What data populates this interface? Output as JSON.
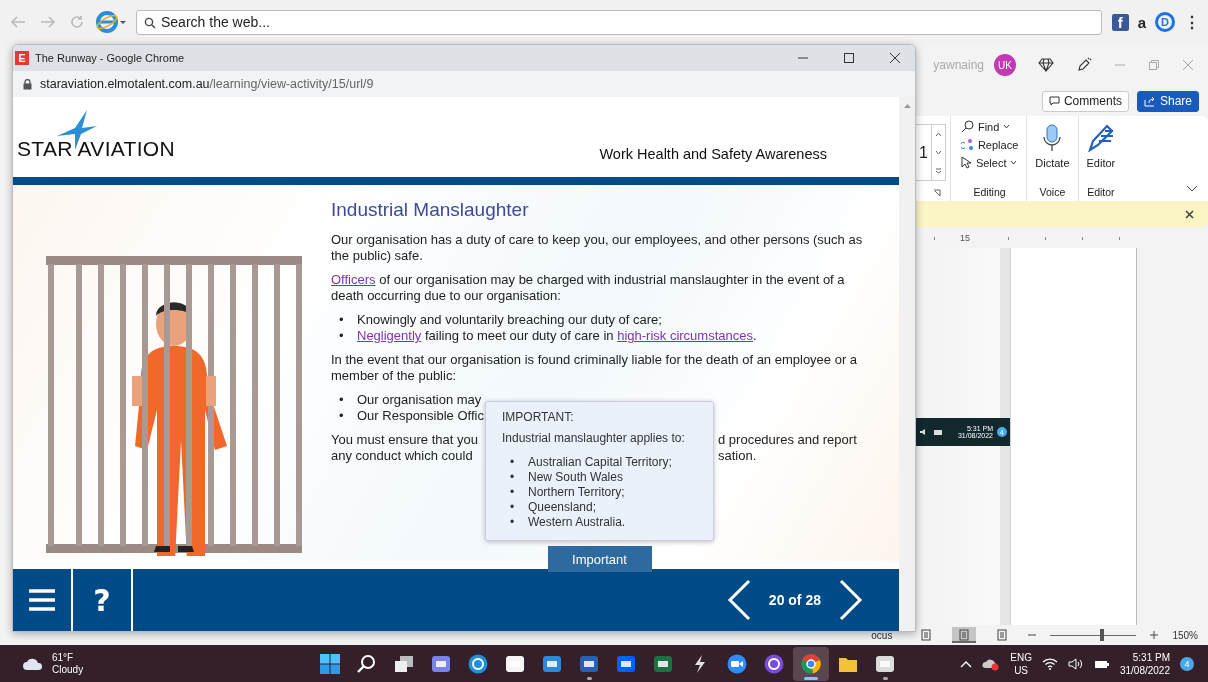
{
  "browser_bar": {
    "search": {
      "placeholder": "Search the web..."
    },
    "extensions": [
      {
        "kind": "facebook",
        "label": "f"
      },
      {
        "kind": "amazon",
        "label": "a"
      },
      {
        "kind": "circle",
        "label": "D"
      }
    ],
    "menu": "⋮"
  },
  "word_window": {
    "user": "yawnaing",
    "avatar": "UK",
    "comments": "Comments",
    "share": "Share",
    "font_size": "1",
    "editing": [
      {
        "label": "Find",
        "kind": "find",
        "dropdown": true
      },
      {
        "label": "Replace",
        "kind": "replace",
        "dropdown": false
      },
      {
        "label": "Select",
        "kind": "select",
        "dropdown": true
      }
    ],
    "big_buttons": [
      {
        "label": "Dictate",
        "kind": "mic"
      },
      {
        "label": "Editor",
        "kind": "pen"
      }
    ],
    "groups": [
      "Editing",
      "Voice",
      "Editor"
    ],
    "ruler_mark": "15",
    "embedded_clock": {
      "time": "5:31 PM",
      "date": "31/08/2022",
      "badge": "4"
    },
    "status_bar": {
      "focus": "ocus",
      "views": [
        {
          "selected": false
        },
        {
          "selected": true
        },
        {
          "selected": false
        }
      ],
      "zoom": {
        "level": 0.6
      },
      "zoom_reading": "150%"
    }
  },
  "chrome_window": {
    "favicon": "E",
    "title": "The Runway - Google Chrome",
    "url_host": "staraviation.elmotalent.com.au",
    "url_path": "/learning/view-activity/15/url/9"
  },
  "course": {
    "logo": "STAR AVIATION",
    "course_title": "Work Health and Safety Awareness",
    "heading": "Industrial Manslaughter",
    "blocks": [
      {
        "kind": "text",
        "segments": [
          {
            "text": "Our organisation has a duty of care to keep you, our employees, and other persons (such as the public) safe.",
            "link": false
          }
        ]
      },
      {
        "kind": "text",
        "segments": [
          {
            "text": "Officers",
            "link": true
          },
          {
            "text": " of our organisation may be charged with industrial manslaughter in the event of a death occurring due to our organisation:",
            "link": false
          }
        ]
      },
      {
        "kind": "bullets",
        "marker": "•",
        "items": [
          [
            {
              "text": "Knowingly and voluntarily breaching our duty of care;",
              "link": false
            }
          ],
          [
            {
              "text": "Negligently",
              "link": true
            },
            {
              "text": " failing to meet our duty of care in ",
              "link": false
            },
            {
              "text": "high-risk circumstances",
              "link": true
            },
            {
              "text": ".",
              "link": false
            }
          ]
        ]
      },
      {
        "kind": "text",
        "segments": [
          {
            "text": "In the event that our organisation is found criminally liable for the death of an employee or a member of the public:",
            "link": false
          }
        ]
      },
      {
        "kind": "bullets",
        "marker": "•",
        "items": [
          [
            {
              "text": "Our organisation may",
              "link": false
            }
          ],
          [
            {
              "text": "Our Responsible Offic",
              "link": false
            }
          ]
        ]
      },
      {
        "kind": "split",
        "lines": [
          {
            "left": "You must ensure that you",
            "right": "d procedures and report"
          },
          {
            "left": "any conduct which could",
            "right": "sation."
          }
        ]
      }
    ],
    "tooltip": {
      "title": "IMPORTANT:",
      "intro": "Industrial manslaughter applies to:",
      "marker": "•",
      "items": [
        "Australian Capital Territory;",
        "New South Wales",
        "Northern Territory;",
        "Queensland;",
        "Western Australia."
      ]
    },
    "important_button": "Important",
    "help": "?",
    "position": "20 of 28"
  },
  "taskbar": {
    "weather": {
      "temp": "61°F",
      "condition": "Cloudy"
    },
    "apps": [
      {
        "kind": "start",
        "running": false,
        "selected": false
      },
      {
        "kind": "search",
        "running": false,
        "selected": false
      },
      {
        "kind": "taskview",
        "running": false,
        "selected": false
      },
      {
        "kind": "chat",
        "running": false,
        "selected": false
      },
      {
        "kind": "edge",
        "running": false,
        "selected": false
      },
      {
        "kind": "store",
        "running": false,
        "selected": false
      },
      {
        "kind": "mail",
        "running": false,
        "selected": false
      },
      {
        "kind": "word",
        "running": true,
        "selected": false
      },
      {
        "kind": "dropbox",
        "running": false,
        "selected": false
      },
      {
        "kind": "excel",
        "running": false,
        "selected": false
      },
      {
        "kind": "bolt",
        "running": false,
        "selected": false
      },
      {
        "kind": "zoom",
        "running": false,
        "selected": false
      },
      {
        "kind": "ring",
        "running": false,
        "selected": false
      },
      {
        "kind": "chrome",
        "running": true,
        "selected": true
      },
      {
        "kind": "folder",
        "running": false,
        "selected": false
      },
      {
        "kind": "remote",
        "running": true,
        "selected": false
      }
    ],
    "language": [
      "ENG",
      "US"
    ],
    "time": "5:31 PM",
    "date": "31/08/2022",
    "badge": "4"
  }
}
